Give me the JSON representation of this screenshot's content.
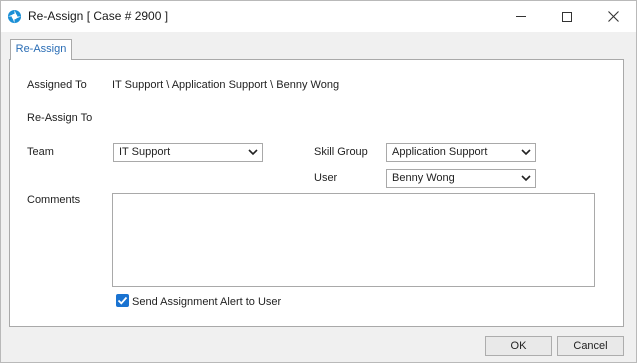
{
  "window": {
    "title": "Re-Assign [ Case # 2900 ]",
    "icons": {
      "app": "app-logo-icon",
      "minimize": "minimize-icon",
      "maximize": "maximize-icon",
      "close": "close-icon"
    }
  },
  "tab": {
    "label": "Re-Assign"
  },
  "form": {
    "assigned_to_label": "Assigned To",
    "assigned_to_value": "IT Support \\ Application Support \\ Benny Wong",
    "reassign_to_label": "Re-Assign To",
    "team_label": "Team",
    "team_value": "IT Support",
    "skill_group_label": "Skill Group",
    "skill_group_value": "Application Support",
    "user_label": "User",
    "user_value": "Benny Wong",
    "comments_label": "Comments",
    "comments_value": "",
    "alert_label": "Send Assignment Alert to User",
    "alert_checked": true
  },
  "footer": {
    "ok_label": "OK",
    "cancel_label": "Cancel"
  },
  "colors": {
    "accent": "#1a73d1",
    "tab_text": "#2a6db5"
  }
}
